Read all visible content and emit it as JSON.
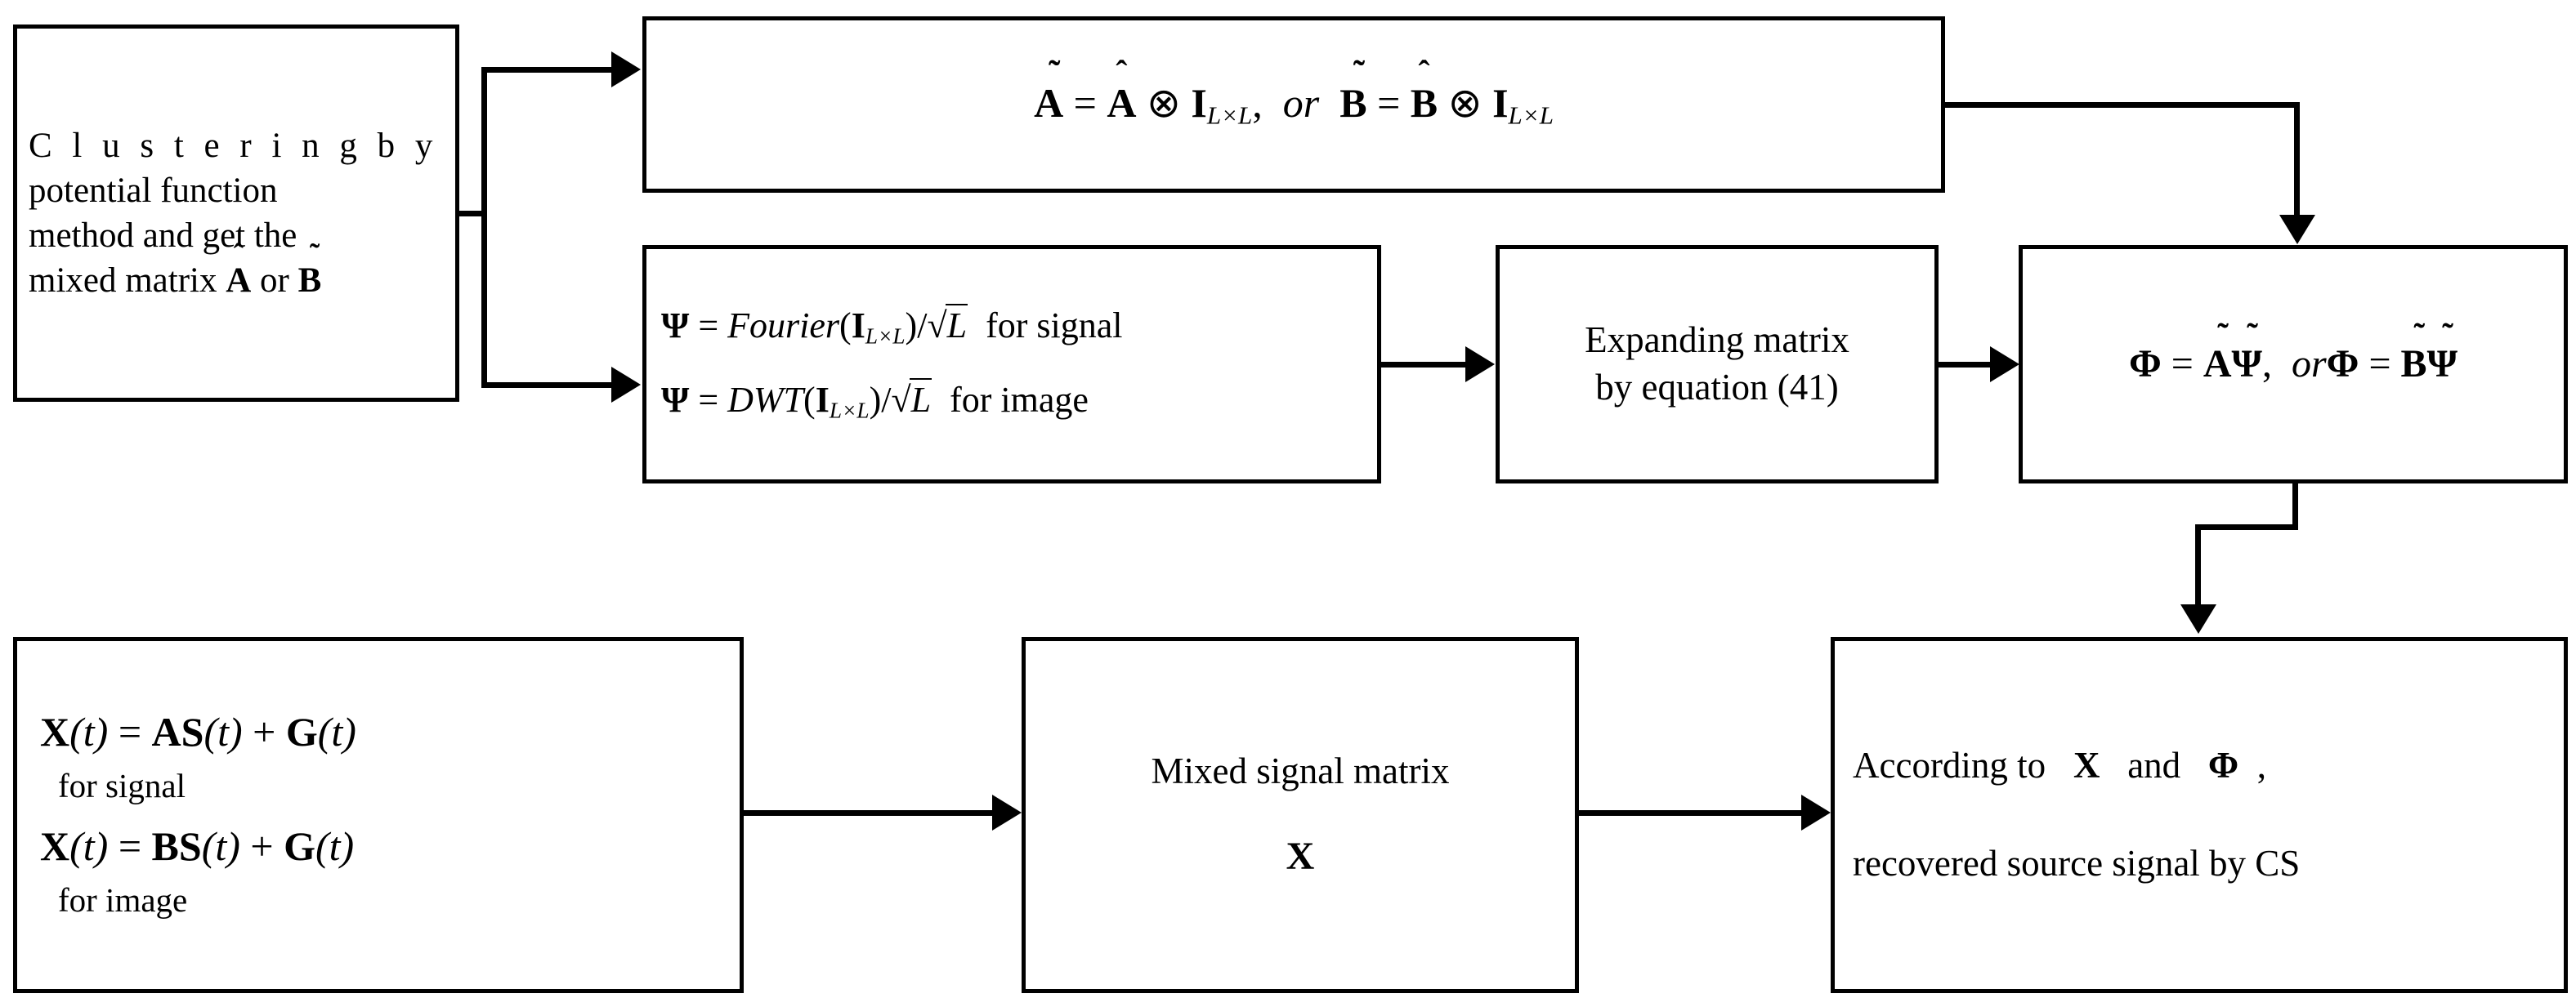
{
  "diagram": {
    "title": "Clustering and compressed-sensing recovery flowchart",
    "boxes": {
      "clustering": {
        "line1": "C l u s t e r i n g   b y",
        "line2": "potential function",
        "line3": "method and get the",
        "line4_pre": "mixed matrix ",
        "line4_a": "A",
        "line4_mid": " or ",
        "line4_b": "B"
      },
      "kron": {
        "lhs1": "A",
        "eq": "=",
        "rhs1": "A",
        "otimes": "⊗",
        "identity": "I",
        "ident_sub": "L×L",
        "comma": ",",
        "or": "or",
        "lhs2": "B",
        "rhs2": "B",
        "full": "Ã = Â ⊗ I_{L×L},  or  B̃ = B̂ ⊗ I_{L×L}"
      },
      "psi": {
        "row1": {
          "sym": "Ψ",
          "eq": "=",
          "fn": "Fourier",
          "arg": "I",
          "arg_sub": "L×L",
          "div": "/",
          "root": "L",
          "note": "for signal"
        },
        "row2": {
          "sym": "Ψ",
          "eq": "=",
          "fn": "DWT",
          "arg": "I",
          "arg_sub": "L×L",
          "div": "/",
          "root": "L",
          "note": "for image"
        }
      },
      "expand": {
        "line1": "Expanding matrix",
        "line2": "by equation (41)"
      },
      "phi": {
        "lhs1": "Φ",
        "eq": "=",
        "a_tilde": "A",
        "psi_tilde": "Ψ",
        "comma": ",",
        "or": "or",
        "lhs2": "Φ",
        "b_tilde": "B",
        "full": "Φ = ÃΨ̃,  orΦ = B̃Ψ̃"
      },
      "model": {
        "eq1": {
          "x": "X",
          "t1": "(t)",
          "eq": "=",
          "m": "AS",
          "t2": "(t)",
          "plus": "+",
          "g": "G",
          "t3": "(t)"
        },
        "note1": "for signal",
        "eq2": {
          "x": "X",
          "t1": "(t)",
          "eq": "=",
          "m": "BS",
          "t2": "(t)",
          "plus": "+",
          "g": "G",
          "t3": "(t)"
        },
        "note2": "for image"
      },
      "mixed": {
        "line1": "Mixed signal matrix",
        "symbol": "X"
      },
      "recover": {
        "pre": "According to",
        "sym_x": "X",
        "mid": "and",
        "sym_phi": "Φ",
        "comma": ",",
        "line2": "recovered  source signal by CS"
      }
    },
    "colors": {
      "stroke": "#000000",
      "background": "#ffffff"
    }
  }
}
